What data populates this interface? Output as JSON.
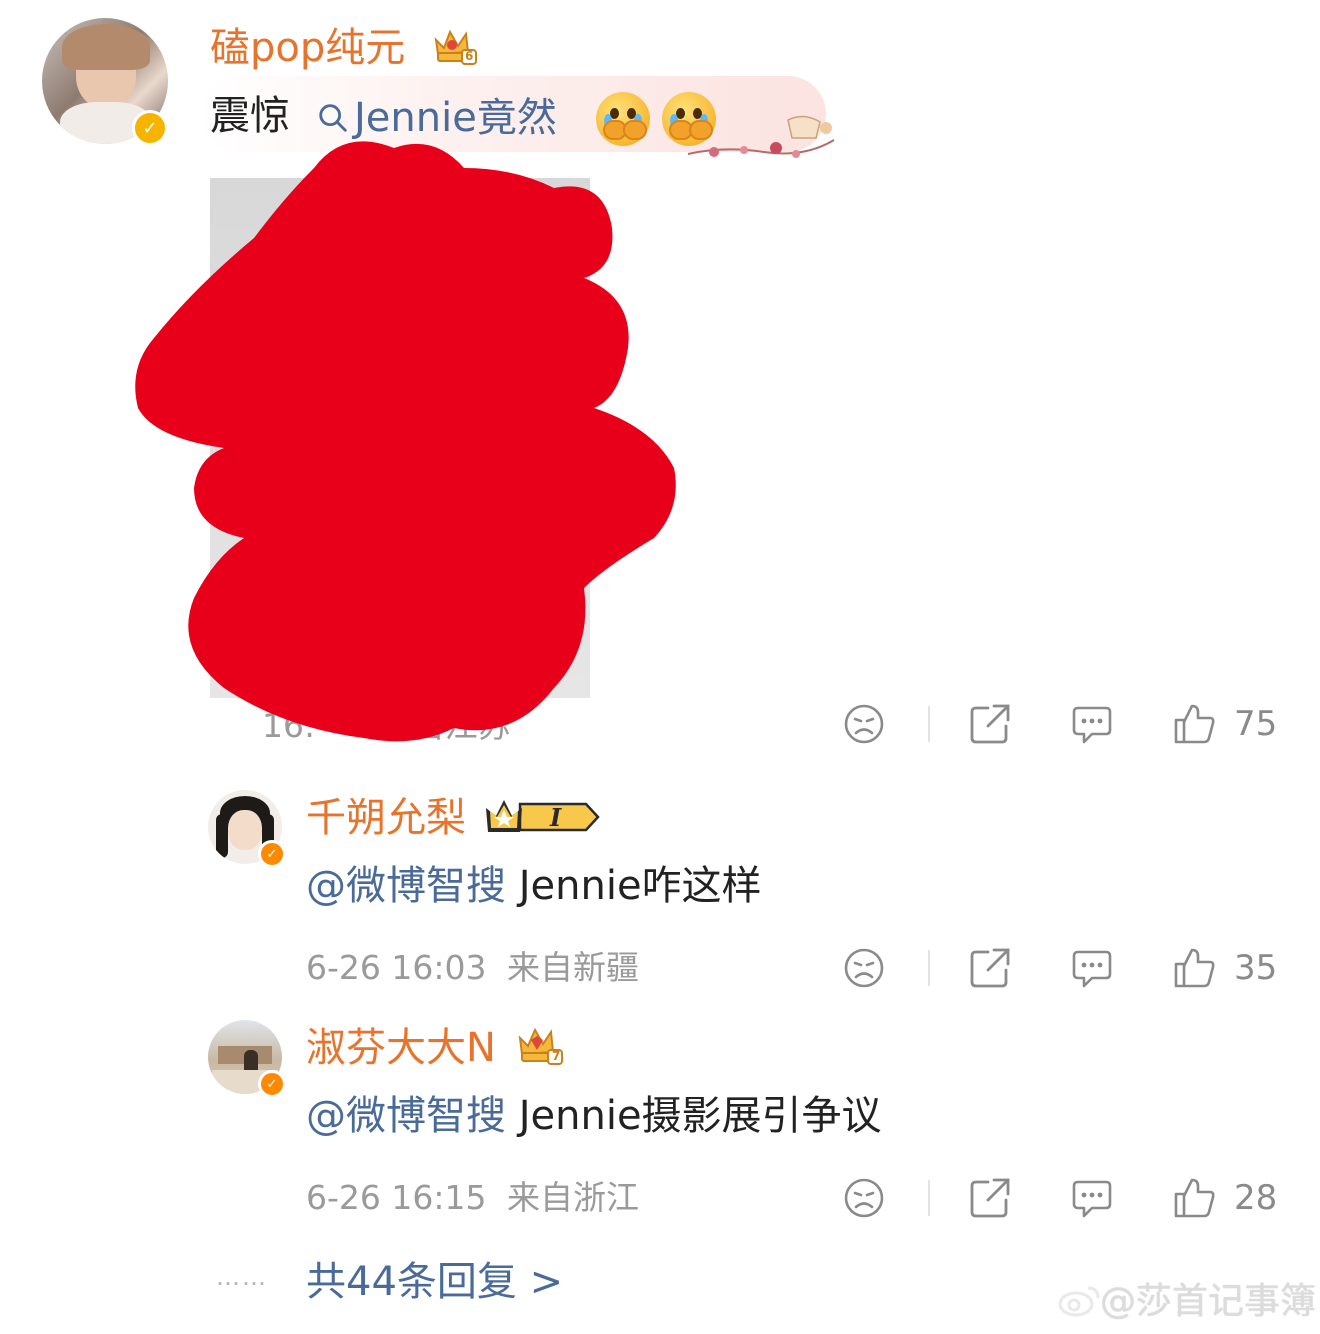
{
  "main_comment": {
    "username": "磕pop纯元",
    "level_badge": "6",
    "text_prefix": "震惊",
    "search_keyword": "Jennie竟然",
    "emojis": [
      "crying-emoji",
      "crying-emoji"
    ],
    "timestamp_partial": "16:",
    "location_partial": "自江苏",
    "likes": "75"
  },
  "replies": [
    {
      "username": "千朔允梨",
      "badge_label": "I",
      "mention": "@微博智搜",
      "text": " Jennie咋这样",
      "timestamp": "6-26 16:03",
      "location": "来自新疆",
      "likes": "35"
    },
    {
      "username": "淑芬大大N",
      "level_badge": "7",
      "mention": "@微博智搜",
      "text": " Jennie摄影展引争议",
      "timestamp": "6-26 16:15",
      "location": "来自浙江",
      "likes": "28"
    }
  ],
  "more_replies": {
    "dots": "……",
    "label": "共44条回复 >"
  },
  "watermark": "@莎首记事簿",
  "colors": {
    "username": "#e8732c",
    "mention": "#4a6b9a",
    "meta": "#9a9a9a",
    "redaction": "#e8001b",
    "verified_gold": "#f6b400"
  }
}
